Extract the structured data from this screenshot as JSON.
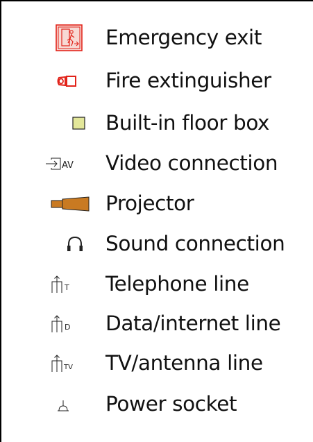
{
  "legend": {
    "items": [
      {
        "label": "Emergency exit",
        "icon": "emergency-exit-icon"
      },
      {
        "label": "Fire extinguisher",
        "icon": "fire-extinguisher-icon"
      },
      {
        "label": "Built-in floor box",
        "icon": "floor-box-icon"
      },
      {
        "label": "Video connection",
        "icon": "video-connection-icon",
        "icon_text": "AV"
      },
      {
        "label": "Projector",
        "icon": "projector-icon"
      },
      {
        "label": "Sound connection",
        "icon": "headphones-icon"
      },
      {
        "label": "Telephone line",
        "icon": "telephone-line-icon",
        "icon_text": "T"
      },
      {
        "label": "Data/internet line",
        "icon": "data-line-icon",
        "icon_text": "D"
      },
      {
        "label": "TV/antenna line",
        "icon": "tv-line-icon",
        "icon_text": "TV"
      },
      {
        "label": "Power socket",
        "icon": "power-socket-icon"
      }
    ],
    "colors": {
      "exit_red": "#e2231a",
      "exit_fill": "#f7d9d4",
      "floor_box_fill": "#e3e79a",
      "projector_orange": "#c97a22",
      "text": "#111111"
    }
  }
}
